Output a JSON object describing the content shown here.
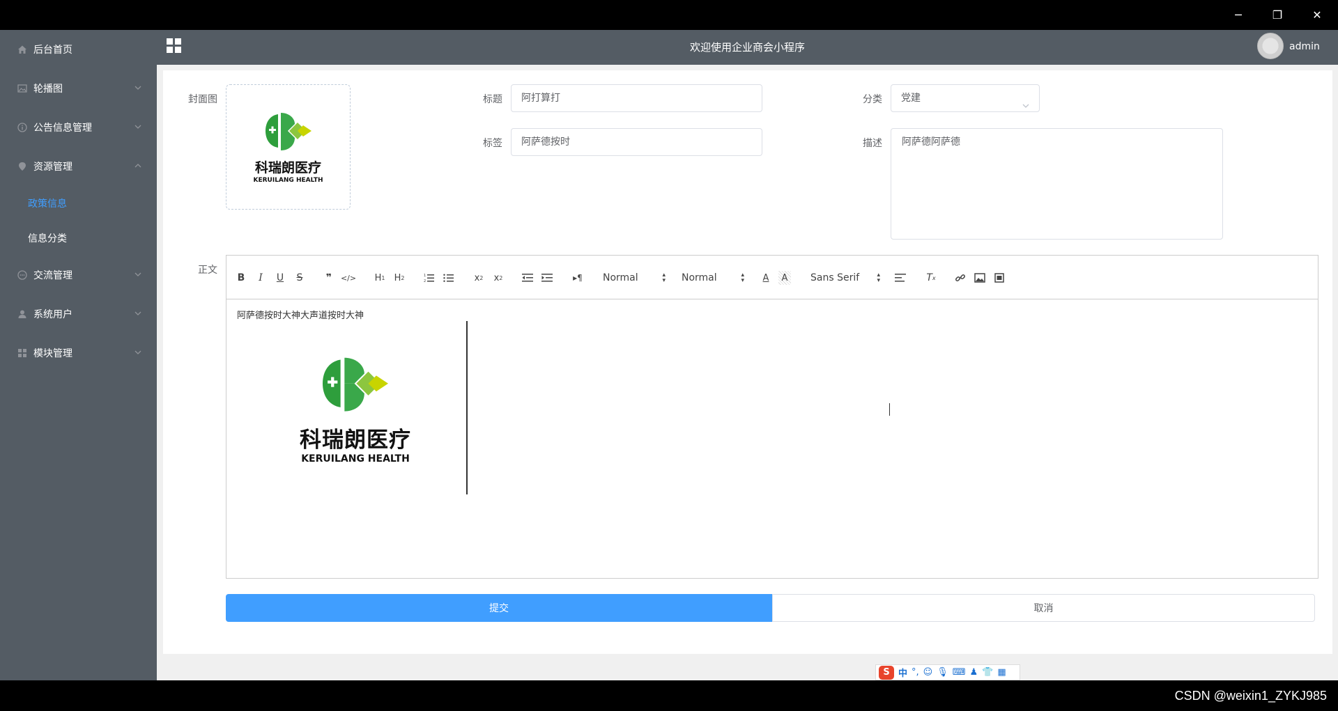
{
  "window": {
    "minimize": "─",
    "restore": "❐",
    "close": "✕"
  },
  "header": {
    "title": "欢迎使用企业商会小程序",
    "user": "admin"
  },
  "sidebar": {
    "items": [
      {
        "label": "后台首页",
        "icon": "home-icon"
      },
      {
        "label": "轮播图",
        "icon": "image-icon"
      },
      {
        "label": "公告信息管理",
        "icon": "info-icon"
      },
      {
        "label": "资源管理",
        "icon": "location-icon"
      },
      {
        "label": "交流管理",
        "icon": "chat-icon"
      },
      {
        "label": "系统用户",
        "icon": "user-icon"
      },
      {
        "label": "模块管理",
        "icon": "grid-icon"
      }
    ],
    "subitems": [
      {
        "label": "政策信息",
        "active": true
      },
      {
        "label": "信息分类",
        "active": false
      }
    ]
  },
  "form": {
    "cover_label": "封面图",
    "title_label": "标题",
    "title_value": "阿打算打",
    "category_label": "分类",
    "category_value": "党建",
    "tag_label": "标签",
    "tag_value": "阿萨德按时",
    "desc_label": "描述",
    "desc_value": "阿萨德阿萨德",
    "body_label": "正文",
    "submit": "提交",
    "cancel": "取消"
  },
  "logo": {
    "cn": "科瑞朗医疗",
    "en": "KERUILANG HEALTH"
  },
  "toolbar": {
    "header_select": "Normal",
    "size_select": "Normal",
    "font_select": "Sans Serif"
  },
  "editor": {
    "text": "阿萨德按时大神大声道按时大神"
  },
  "ime": {
    "mode": "中"
  },
  "watermark": "CSDN @weixin1_ZYKJ985",
  "colors": {
    "sidebar": "#545c64",
    "active": "#409eff",
    "primary": "#409eff"
  }
}
